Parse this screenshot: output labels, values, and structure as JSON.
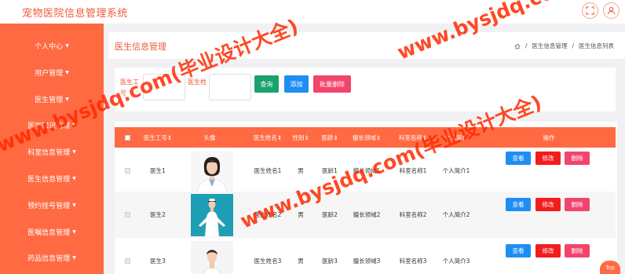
{
  "app": {
    "title": "宠物医院信息管理系统"
  },
  "sidebar": {
    "items": [
      {
        "label": "个人中心"
      },
      {
        "label": "用户管理"
      },
      {
        "label": "医生管理"
      },
      {
        "label": "医学知识管理"
      },
      {
        "label": "科室信息管理"
      },
      {
        "label": "医生信息管理"
      },
      {
        "label": "预约挂号管理"
      },
      {
        "label": "医嘱信息管理"
      },
      {
        "label": "药品信息管理"
      }
    ]
  },
  "page": {
    "title": "医生信息管理",
    "breadcrumb": [
      "医生信息管理",
      "医生信息列表"
    ]
  },
  "search": {
    "field1_label": "医生工号",
    "field2_label": "医生姓名",
    "field1_value": "",
    "field2_value": "",
    "query_label": "查询",
    "add_label": "添加",
    "batch_delete_label": "批量删除"
  },
  "table": {
    "headers": [
      "医生工号",
      "头像",
      "医生姓名",
      "性别",
      "医龄",
      "擅长领域",
      "科室名称",
      "个人简介",
      "操作"
    ],
    "rows": [
      {
        "id": "医生1",
        "name": "医生姓名1",
        "gender": "男",
        "age": "医龄1",
        "field": "擅长领域1",
        "dept": "科室名称1",
        "intro": "个人简介1"
      },
      {
        "id": "医生2",
        "name": "医生姓名2",
        "gender": "男",
        "age": "医龄2",
        "field": "擅长领域2",
        "dept": "科室名称2",
        "intro": "个人简介2"
      },
      {
        "id": "医生3",
        "name": "医生姓名3",
        "gender": "男",
        "age": "医龄3",
        "field": "擅长领域3",
        "dept": "科室名称3",
        "intro": "个人简介3"
      }
    ],
    "actions": {
      "view": "查看",
      "edit": "修改",
      "delete": "删除"
    }
  },
  "watermark": {
    "line1": "www.bysjdq.com(毕业设计大全)",
    "line2": "www.bysjdq.com(毕业设计大全)",
    "line3": "www.bysjdq.com(毕业设计大全)"
  },
  "back_to_top": "Top",
  "colors": {
    "accent": "#ff6a43",
    "title": "#ef5b3c",
    "query": "#1aa26f",
    "add": "#1e8ef5",
    "delete": "#f2456c",
    "edit": "#f21d1d"
  }
}
